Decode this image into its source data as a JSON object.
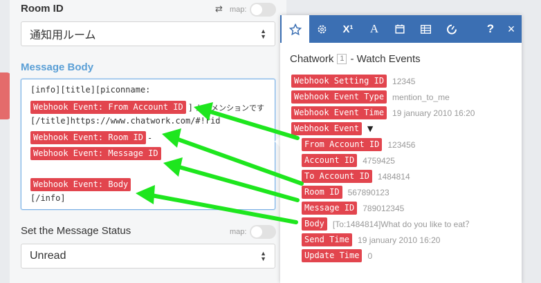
{
  "left": {
    "room_id_label": "Room ID",
    "map_label": "map:",
    "room_select_value": "通知用ルーム",
    "message_body_label": "Message Body",
    "status_label": "Set the Message Status",
    "status_select_value": "Unread"
  },
  "body": {
    "line1": "[info][title][piconname:",
    "pill_from": "Webhook Event: From Account ID",
    "after_from_bracket": "]",
    "after_from_jp": "からメンションです",
    "line3": "[/title]https://www.chatwork.com/#!rid",
    "pill_room": "Webhook Event: Room ID",
    "after_room": "-",
    "pill_msg": "Webhook Event: Message ID",
    "pill_body": "Webhook Event: Body",
    "line_end": "[/info]"
  },
  "popup": {
    "toolbar": [
      "star-icon",
      "gear-icon",
      "superscript-icon",
      "text-format-icon",
      "calendar-icon",
      "table-icon",
      "gauge-icon",
      "help-icon",
      "close-icon"
    ],
    "toolbar_labels": {
      "superscript": "X¹",
      "font": "A",
      "help": "?",
      "close": "×"
    },
    "module_name": "Chatwork",
    "module_number": "1",
    "module_event": "- Watch Events",
    "rows": [
      {
        "label": "Webhook Setting ID",
        "value": "12345"
      },
      {
        "label": "Webhook Event Type",
        "value": "mention_to_me"
      },
      {
        "label": "Webhook Event Time",
        "value": "19 january 2010 16:20"
      },
      {
        "label": "Webhook Event",
        "value": ""
      },
      {
        "label": "From Account ID",
        "value": "123456"
      },
      {
        "label": "Account ID",
        "value": "4759425"
      },
      {
        "label": "To Account ID",
        "value": "1484814"
      },
      {
        "label": "Room ID",
        "value": "567890123"
      },
      {
        "label": "Message ID",
        "value": "789012345"
      },
      {
        "label": "Body",
        "value": "[To:1484814]What do you like to eat？"
      },
      {
        "label": "Send Time",
        "value": "19 january 2010 16:20"
      },
      {
        "label": "Update Time",
        "value": "0"
      }
    ]
  },
  "colors": {
    "pill": "#e2454e",
    "toolbar": "#3b6fb3",
    "arrow": "#1ee61e",
    "label_blue": "#5a9fd6"
  }
}
